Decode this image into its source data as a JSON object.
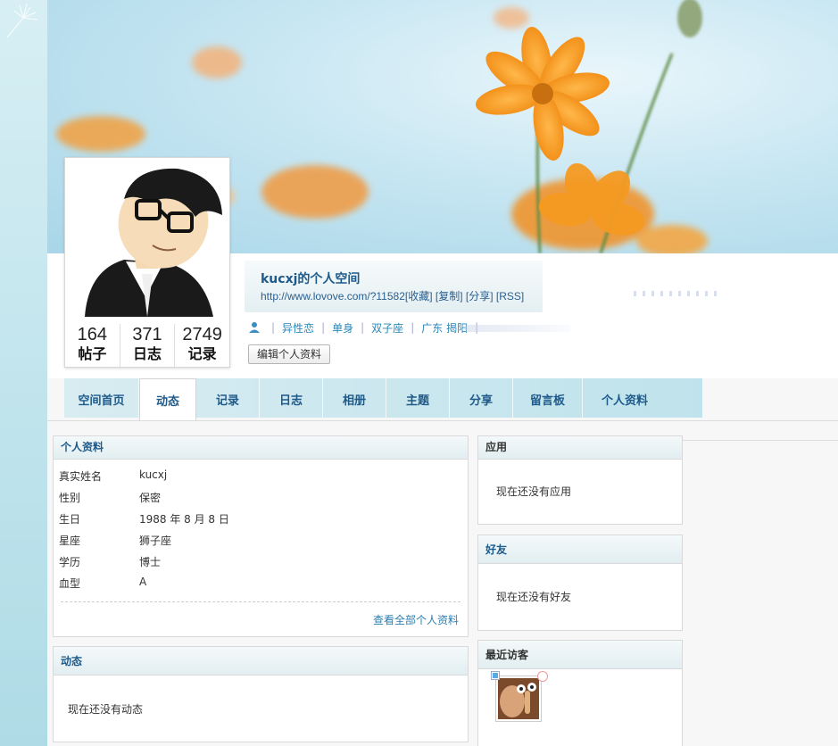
{
  "profile": {
    "space_title": "kucxj的个人空间",
    "url": "http://www.lovove.com/?11582",
    "link_actions": [
      "[收藏]",
      "[复制]",
      "[分享]",
      "[RSS]"
    ],
    "info": [
      "异性恋",
      "单身",
      "双子座",
      "广东 揭阳"
    ],
    "edit_label": "编辑个人资料",
    "stats": [
      {
        "num": "164",
        "label": "帖子"
      },
      {
        "num": "371",
        "label": "日志"
      },
      {
        "num": "2749",
        "label": "记录"
      }
    ]
  },
  "nav": {
    "tabs": [
      "空间首页",
      "动态",
      "记录",
      "日志",
      "相册",
      "主题",
      "分享",
      "留言板",
      "个人资料"
    ],
    "active": "动态"
  },
  "profile_panel": {
    "title": "个人资料",
    "rows": [
      {
        "key": "真实姓名",
        "value": "kucxj"
      },
      {
        "key": "性别",
        "value": "保密"
      },
      {
        "key": "生日",
        "value": "1988 年 8 月 8 日"
      },
      {
        "key": "星座",
        "value": "狮子座"
      },
      {
        "key": "学历",
        "value": "博士"
      },
      {
        "key": "血型",
        "value": "A"
      }
    ],
    "see_all": "查看全部个人资料"
  },
  "feed_panel": {
    "title": "动态",
    "empty": "现在还没有动态"
  },
  "apps_panel": {
    "title": "应用",
    "empty": "现在还没有应用"
  },
  "friends_panel": {
    "title": "好友",
    "empty": "现在还没有好友"
  },
  "visitors_panel": {
    "title": "最近访客"
  },
  "colors": {
    "link": "#2a7fb0",
    "title_blue": "#1e5a8a",
    "accent_orange": "#f29a1d"
  }
}
